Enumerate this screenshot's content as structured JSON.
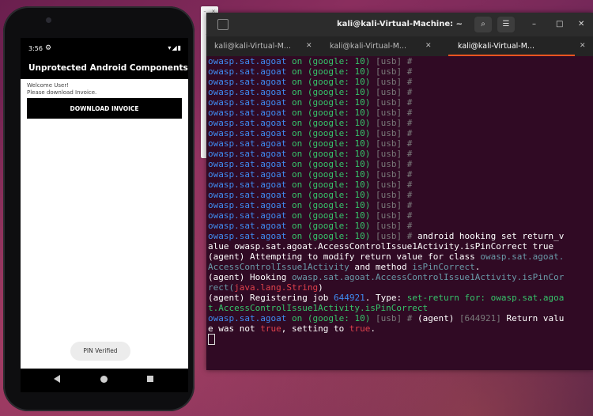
{
  "phone": {
    "status_time": "3:56",
    "status_icons": "▾◢▮",
    "app_title": "Unprotected Android Components",
    "welcome_line1": "Welcome User!",
    "welcome_line2": "Please download Invoice.",
    "download_button": "DOWNLOAD INVOICE",
    "toast": "PIN Verified"
  },
  "emulator_toolbar": {
    "top": [
      "–",
      "×"
    ],
    "buttons": [
      "power-icon",
      "volume-up-icon",
      "volume-down-icon",
      "rotate-left-icon",
      "rotate-right-icon",
      "camera-icon",
      "zoom-icon",
      "back-icon",
      "home-icon",
      "overview-icon",
      "more-icon"
    ]
  },
  "terminal": {
    "window_title": "kali@kali-Virtual-Machine: ~",
    "tabs": [
      "kali@kali-Virtual-M...",
      "kali@kali-Virtual-M...",
      "kali@kali-Virtual-M..."
    ],
    "prompt_app": "owasp.sat.agoat",
    "prompt_on": "on",
    "prompt_device": "(google: 10)",
    "prompt_usb": "[usb]",
    "prompt_hash": "#",
    "command": "android hooking set return_value owasp.sat.agoat.AccessControlIssue1Activity.isPinCorrect true",
    "out_attempt_prefix": "(agent) Attempting to modify return value for class ",
    "out_attempt_class": "owasp.sat.agoat.AccessControlIssue1Activity",
    "out_attempt_mid": " and method ",
    "out_attempt_method": "isPinCorrect",
    "out_attempt_end": ".",
    "out_hooking_prefix": "(agent) Hooking ",
    "out_hooking_target": "owasp.sat.agoat.AccessControlIssue1Activity.isPinCorrect(",
    "out_hooking_arg": "java.lang.String",
    "out_hooking_end": ")",
    "out_register_prefix": "(agent) Registering job ",
    "out_register_job": "644921",
    "out_register_mid": ". Type: ",
    "out_register_type": "set-return for: owasp.sat.agoat.AccessControlIssue1Activity.isPinCorrect",
    "out_return_prefix": "(agent) ",
    "out_return_job": "[644921]",
    "out_return_mid": " Return value was not ",
    "out_return_true1": "true",
    "out_return_mid2": ", setting to ",
    "out_return_true2": "true",
    "out_return_end": "."
  }
}
